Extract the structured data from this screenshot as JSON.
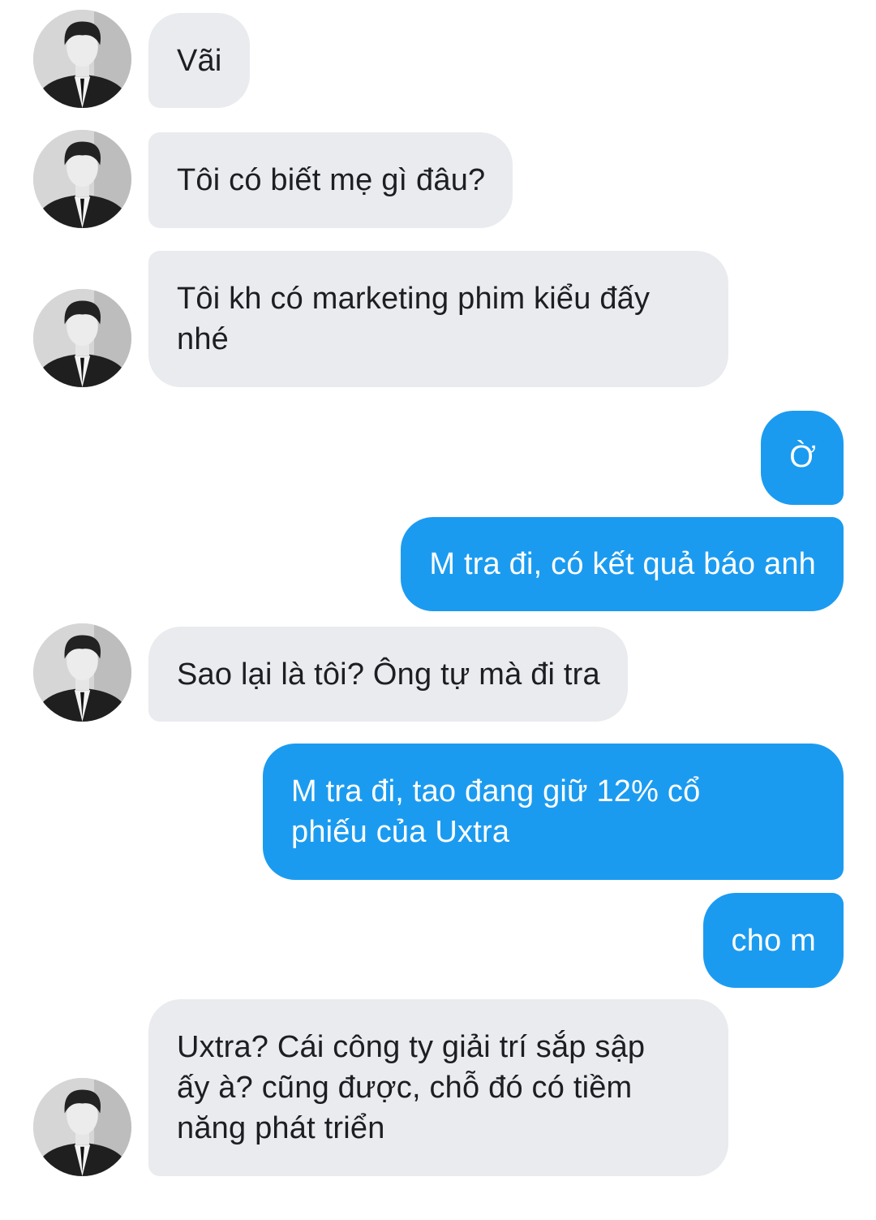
{
  "contact": {
    "avatar_icon": "profile-photo-icon"
  },
  "colors": {
    "incoming_bubble": "#e9ebee",
    "outgoing_bubble": "#1b9bf0",
    "incoming_text": "#1c1e21",
    "outgoing_text": "#ffffff"
  },
  "messages": [
    {
      "sender": "them",
      "lines": [
        "Vãi"
      ]
    },
    {
      "sender": "them",
      "lines": [
        "Tôi có biết mẹ gì đâu?"
      ]
    },
    {
      "sender": "them",
      "lines": [
        "Tôi kh có marketing phim kiểu đấy",
        "nhé"
      ]
    },
    {
      "sender": "me",
      "lines": [
        "Ờ"
      ]
    },
    {
      "sender": "me",
      "lines": [
        "M tra đi, có kết quả báo anh"
      ]
    },
    {
      "sender": "them",
      "lines": [
        "Sao lại là tôi? Ông tự mà đi tra"
      ]
    },
    {
      "sender": "me",
      "lines": [
        "M tra đi, tao đang giữ 12% cổ",
        "phiếu của Uxtra"
      ]
    },
    {
      "sender": "me",
      "lines": [
        "cho m"
      ]
    },
    {
      "sender": "them",
      "lines": [
        "Uxtra? Cái công ty giải trí sắp sập",
        "ấy à? cũng được, chỗ đó có tiềm",
        "năng phát triển"
      ]
    }
  ]
}
